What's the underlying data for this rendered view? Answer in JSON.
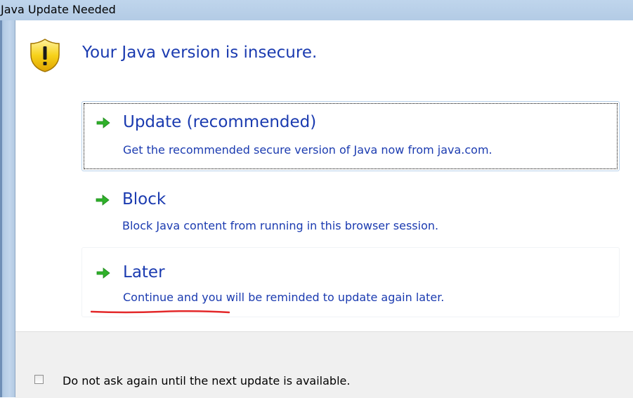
{
  "window": {
    "title": "Java Update Needed"
  },
  "header": {
    "text": "Your Java version is insecure.",
    "icon": "warning-shield-icon"
  },
  "options": [
    {
      "title": "Update (recommended)",
      "description": "Get the recommended secure version of Java now from java.com.",
      "icon": "green-arrow-icon"
    },
    {
      "title": "Block",
      "description": "Block Java content from running in this browser session.",
      "icon": "green-arrow-icon"
    },
    {
      "title": "Later",
      "description": "Continue and you will be reminded to update again later.",
      "icon": "green-arrow-icon"
    }
  ],
  "footer": {
    "checkbox_label": "Do not ask again until the next update is available.",
    "checked": false
  },
  "colors": {
    "link_blue": "#1b3bb0",
    "arrow_green": "#2fb12a",
    "titlebar": "#bfd5ec",
    "annotation_red": "#e3282a"
  }
}
